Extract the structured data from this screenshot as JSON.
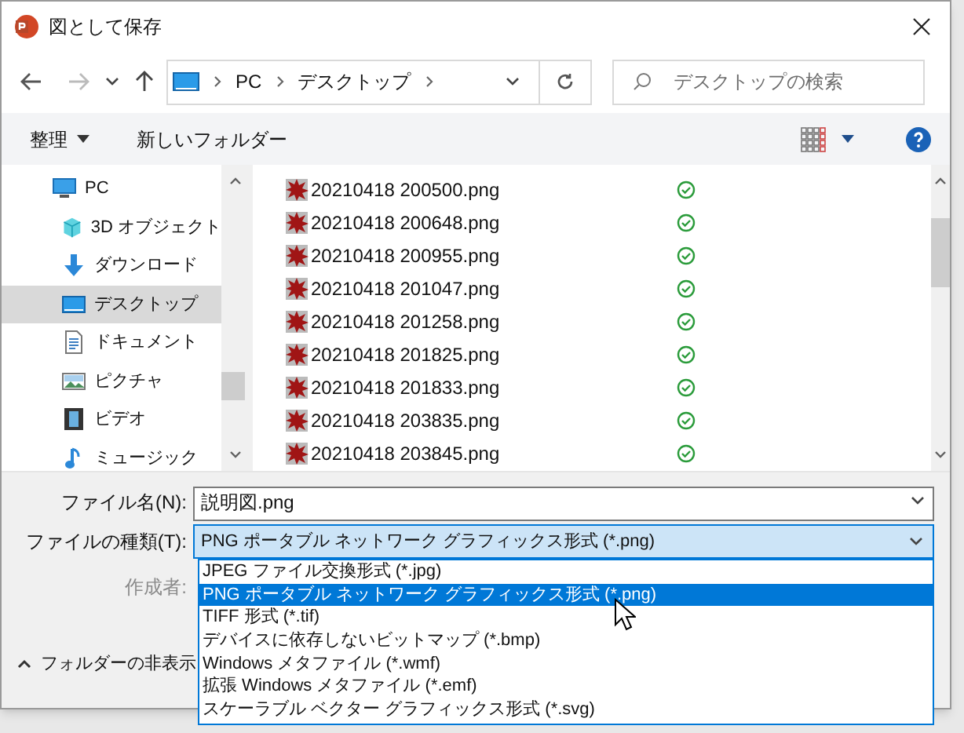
{
  "window": {
    "title": "図として保存"
  },
  "address": {
    "path": [
      {
        "label": "PC"
      },
      {
        "label": "デスクトップ"
      }
    ]
  },
  "search": {
    "placeholder": "デスクトップの検索"
  },
  "toolbar": {
    "organize": "整理",
    "new_folder": "新しいフォルダー"
  },
  "sidebar": {
    "items": [
      {
        "label": "PC",
        "kind": "pc",
        "selected": false,
        "children": [
          {
            "label": "3D オブジェクト",
            "kind": "cube",
            "selected": false
          },
          {
            "label": "ダウンロード",
            "kind": "download",
            "selected": false
          },
          {
            "label": "デスクトップ",
            "kind": "desktop",
            "selected": true
          },
          {
            "label": "ドキュメント",
            "kind": "document",
            "selected": false
          },
          {
            "label": "ピクチャ",
            "kind": "picture",
            "selected": false
          },
          {
            "label": "ビデオ",
            "kind": "video",
            "selected": false
          },
          {
            "label": "ミュージック",
            "kind": "music",
            "selected": false
          }
        ]
      }
    ]
  },
  "files": [
    {
      "name": "20210418 200500.png"
    },
    {
      "name": "20210418 200648.png"
    },
    {
      "name": "20210418 200955.png"
    },
    {
      "name": "20210418 201047.png"
    },
    {
      "name": "20210418 201258.png"
    },
    {
      "name": "20210418 201825.png"
    },
    {
      "name": "20210418 201833.png"
    },
    {
      "name": "20210418 203835.png"
    },
    {
      "name": "20210418 203845.png"
    }
  ],
  "form": {
    "filename_label": "ファイル名(N):",
    "filename": "説明図.png",
    "filetype_label": "ファイルの種類(T):",
    "filetype": "PNG ポータブル ネットワーク グラフィックス形式 (*.png)",
    "author_label": "作成者:",
    "author_disabled": true
  },
  "filetype_options": [
    {
      "label": "JPEG ファイル交換形式 (*.jpg)",
      "selected": false
    },
    {
      "label": "PNG ポータブル ネットワーク グラフィックス形式 (*.png)",
      "selected": true
    },
    {
      "label": "TIFF 形式 (*.tif)",
      "selected": false
    },
    {
      "label": "デバイスに依存しないビットマップ (*.bmp)",
      "selected": false
    },
    {
      "label": "Windows メタファイル (*.wmf)",
      "selected": false
    },
    {
      "label": "拡張 Windows メタファイル (*.emf)",
      "selected": false
    },
    {
      "label": "スケーラブル ベクター グラフィックス形式 (*.svg)",
      "selected": false
    }
  ],
  "hide_folders": "フォルダーの非表示"
}
